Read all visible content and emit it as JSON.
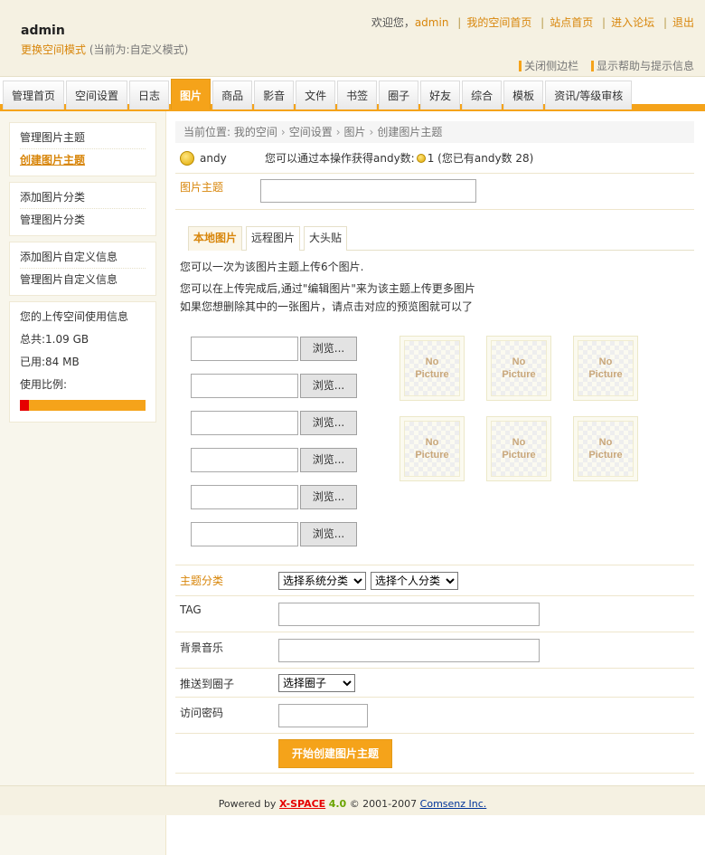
{
  "header": {
    "brand": "admin",
    "mode_link": "更换空间模式",
    "mode_note": "(当前为:自定义模式)",
    "welcome_prefix": "欢迎您，",
    "username": "admin",
    "links": [
      "我的空间首页",
      "站点首页",
      "进入论坛",
      "退出"
    ],
    "close_sidebar": "关闭侧边栏",
    "show_help": "显示帮助与提示信息"
  },
  "nav": {
    "tabs": [
      "管理首页",
      "空间设置",
      "日志",
      "图片",
      "商品",
      "影音",
      "文件",
      "书签",
      "圈子",
      "好友",
      "综合",
      "模板",
      "资讯/等级审核"
    ],
    "active": "图片"
  },
  "sidebar": {
    "group1": [
      "管理图片主题",
      "创建图片主题"
    ],
    "group2": [
      "添加图片分类",
      "管理图片分类"
    ],
    "group3": [
      "添加图片自定义信息",
      "管理图片自定义信息"
    ],
    "usage": {
      "title": "您的上传空间使用信息",
      "total": "总共:1.09 GB",
      "used": "已用:84 MB",
      "ratio_label": "使用比例:",
      "ratio": 0.075
    }
  },
  "breadcrumb": {
    "label": "当前位置:",
    "items": [
      "我的空间",
      "空间设置",
      "图片",
      "创建图片主题"
    ]
  },
  "credit": {
    "name": "andy",
    "text_before": "您可以通过本操作获得andy数:",
    "text_after": "1 (您已有andy数  28)"
  },
  "form": {
    "theme_label": "图片主题",
    "upload_tabs": [
      "本地图片",
      "远程图片",
      "大头贴"
    ],
    "info1": "您可以一次为该图片主题上传6个图片.",
    "info2": "您可以在上传完成后,通过\"编辑图片\"来为该主题上传更多图片",
    "info3": "如果您想删除其中的一张图片，请点击对应的预览图就可以了",
    "browse_label": "浏览...",
    "thumb_line1": "No",
    "thumb_line2": "Picture",
    "category_label": "主题分类",
    "system_category": "选择系统分类",
    "personal_category": "选择个人分类",
    "tag_label": "TAG",
    "music_label": "背景音乐",
    "circle_label": "推送到圈子",
    "circle_select": "选择圈子",
    "password_label": "访问密码",
    "submit_label": "开始创建图片主题"
  },
  "footer": {
    "powered": "Powered by",
    "product": "X-SPACE",
    "version": "4.0",
    "copyright": "© 2001-2007",
    "company": "Comsenz Inc."
  }
}
